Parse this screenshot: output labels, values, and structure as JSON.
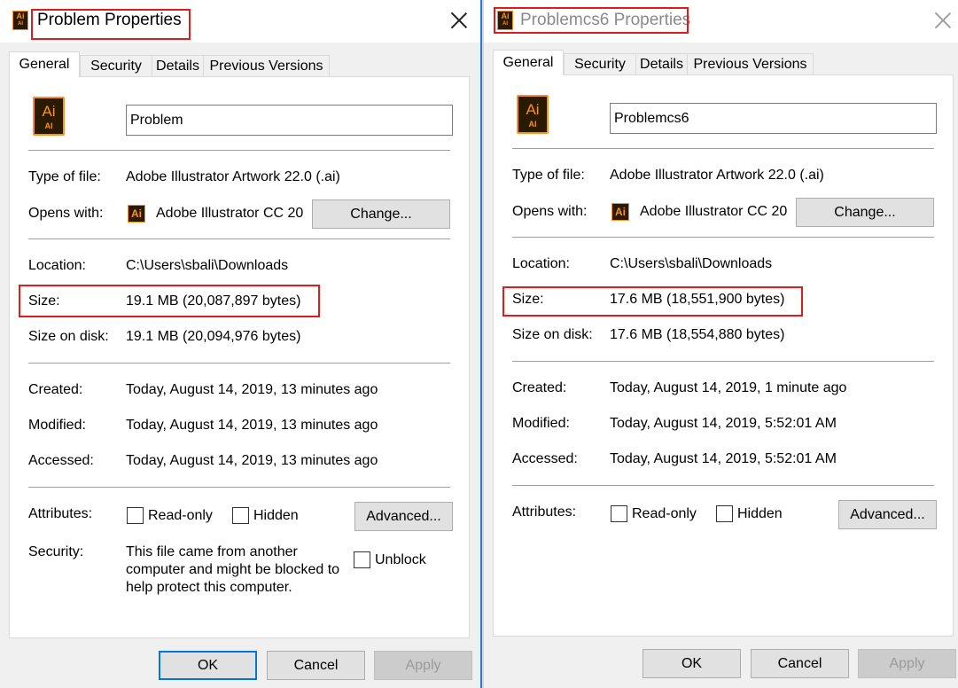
{
  "dialog1": {
    "title": "Problem Properties",
    "tabs": [
      "General",
      "Security",
      "Details",
      "Previous Versions"
    ],
    "file_name": "Problem",
    "type_label": "Type of file:",
    "type_value": "Adobe Illustrator Artwork 22.0 (.ai)",
    "opens_label": "Opens with:",
    "opens_value": "Adobe Illustrator CC 20",
    "change_label": "Change...",
    "location_label": "Location:",
    "location_value": "C:\\Users\\sbali\\Downloads",
    "size_label": "Size:",
    "size_value": "19.1 MB (20,087,897 bytes)",
    "disk_label": "Size on disk:",
    "disk_value": "19.1 MB (20,094,976 bytes)",
    "created_label": "Created:",
    "created_value": "Today, August 14, 2019, 13 minutes ago",
    "modified_label": "Modified:",
    "modified_value": "Today, August 14, 2019, 13 minutes ago",
    "accessed_label": "Accessed:",
    "accessed_value": "Today, August 14, 2019, 13 minutes ago",
    "attributes_label": "Attributes:",
    "readonly_label": "Read-only",
    "hidden_label": "Hidden",
    "advanced_label": "Advanced...",
    "security_label": "Security:",
    "security_text": "This file came from another computer and might be blocked to help protect this computer.",
    "unblock_label": "Unblock",
    "ok_label": "OK",
    "cancel_label": "Cancel",
    "apply_label": "Apply"
  },
  "dialog2": {
    "title": "Problemcs6 Properties",
    "tabs": [
      "General",
      "Security",
      "Details",
      "Previous Versions"
    ],
    "file_name": "Problemcs6",
    "type_label": "Type of file:",
    "type_value": "Adobe Illustrator Artwork 22.0 (.ai)",
    "opens_label": "Opens with:",
    "opens_value": "Adobe Illustrator CC 20",
    "change_label": "Change...",
    "location_label": "Location:",
    "location_value": "C:\\Users\\sbali\\Downloads",
    "size_label": "Size:",
    "size_value": "17.6 MB (18,551,900 bytes)",
    "disk_label": "Size on disk:",
    "disk_value": "17.6 MB (18,554,880 bytes)",
    "created_label": "Created:",
    "created_value": "Today, August 14, 2019, 1 minute ago",
    "modified_label": "Modified:",
    "modified_value": "Today, August 14, 2019, 5:52:01 AM",
    "accessed_label": "Accessed:",
    "accessed_value": "Today, August 14, 2019, 5:52:01 AM",
    "attributes_label": "Attributes:",
    "readonly_label": "Read-only",
    "hidden_label": "Hidden",
    "advanced_label": "Advanced...",
    "ok_label": "OK",
    "cancel_label": "Cancel",
    "apply_label": "Apply"
  },
  "icons": {
    "ai_text": "Ai",
    "ai_sub": "AI"
  },
  "colors": {
    "highlight": "#e01b1b",
    "ai_orange": "#f7931e",
    "ai_dark": "#2b1a02",
    "focus_blue": "#0078d7"
  }
}
